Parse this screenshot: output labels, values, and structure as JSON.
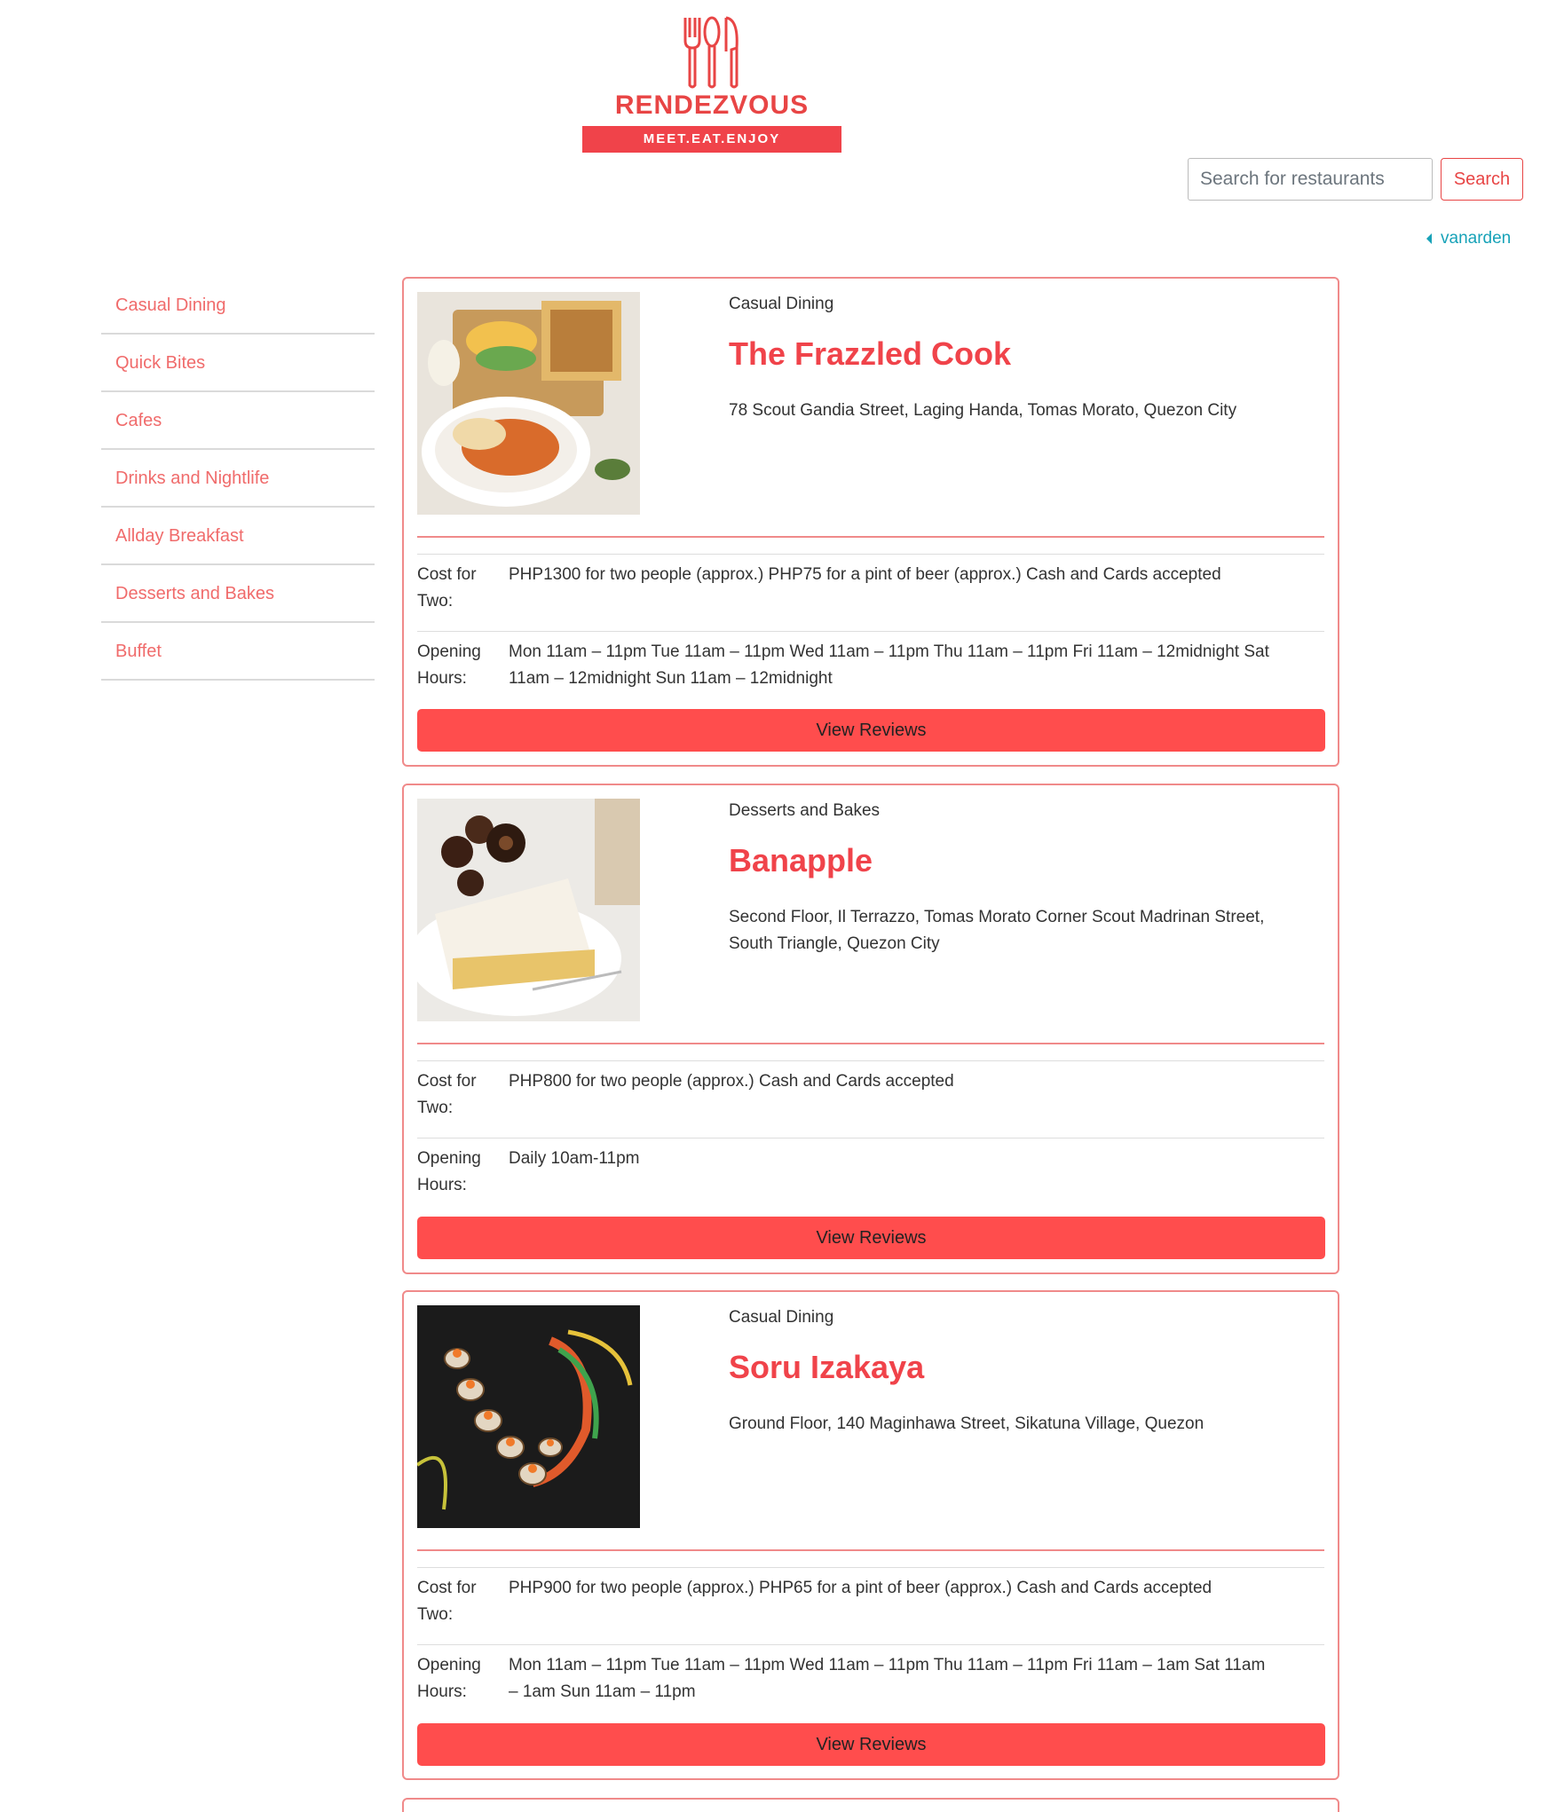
{
  "brand": {
    "name": "RENDEZVOUS",
    "tagline": "MEET.EAT.ENJOY"
  },
  "search": {
    "placeholder": "Search for restaurants",
    "button_label": "Search"
  },
  "user": {
    "name": "vanarden"
  },
  "sidebar": {
    "items": [
      {
        "label": "Casual Dining"
      },
      {
        "label": "Quick Bites"
      },
      {
        "label": "Cafes"
      },
      {
        "label": "Drinks and Nightlife"
      },
      {
        "label": "Allday Breakfast"
      },
      {
        "label": "Desserts and Bakes"
      },
      {
        "label": "Buffet"
      }
    ]
  },
  "restaurants": [
    {
      "category": "Casual Dining",
      "name": "The Frazzled Cook",
      "address": "78 Scout Gandia Street, Laging Handa, Tomas Morato, Quezon City",
      "cost_label": "Cost for Two:",
      "cost": "PHP1300 for two people (approx.) PHP75 for a pint of beer (approx.) Cash and Cards accepted",
      "hours_label": "Opening Hours:",
      "hours": "Mon 11am – 11pm Tue 11am – 11pm Wed 11am – 11pm Thu 11am – 11pm Fri 11am – 12midnight Sat 11am – 12midnight Sun 11am – 12midnight",
      "reviews_label": "View Reviews"
    },
    {
      "category": "Desserts and Bakes",
      "name": "Banapple",
      "address": "Second Floor, Il Terrazzo, Tomas Morato Corner Scout Madrinan Street, South Triangle, Quezon City",
      "cost_label": "Cost for Two:",
      "cost": "PHP800 for two people (approx.) Cash and Cards accepted",
      "hours_label": "Opening Hours:",
      "hours": "Daily 10am-11pm",
      "reviews_label": "View Reviews"
    },
    {
      "category": "Casual Dining",
      "name": "Soru Izakaya",
      "address": "Ground Floor, 140 Maginhawa Street, Sikatuna Village, Quezon",
      "cost_label": "Cost for Two:",
      "cost": "PHP900 for two people (approx.) PHP65 for a pint of beer (approx.) Cash and Cards accepted",
      "hours_label": "Opening Hours:",
      "hours": "Mon 11am – 11pm Tue 11am – 11pm Wed 11am – 11pm Thu 11am – 11pm Fri 11am – 1am Sat 11am – 1am Sun 11am – 11pm",
      "reviews_label": "View Reviews"
    }
  ],
  "colors": {
    "accent": "#f0434a",
    "button": "#ff4d4d",
    "sidebar_text": "#f06b6b",
    "user_link": "#17a2b8",
    "card_border": "#f08a8a"
  }
}
